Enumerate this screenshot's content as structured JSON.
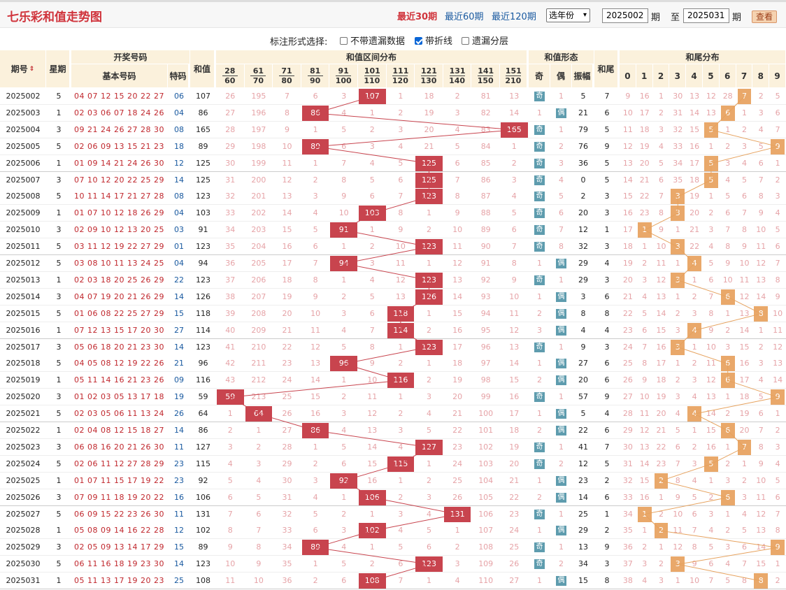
{
  "app": {
    "title": "七乐彩和值走势图",
    "ranges": [
      "最近30期",
      "最近60期",
      "最近120期"
    ],
    "year_select": "选年份",
    "from_issue": "2025002",
    "to_issue": "2025031",
    "period_label": "期",
    "to_label": "至",
    "query_button": "查看"
  },
  "options": {
    "label": "标注形式选择:",
    "items": [
      {
        "label": "不带遗漏数据",
        "checked": false
      },
      {
        "label": "带折线",
        "checked": true
      },
      {
        "label": "遗漏分层",
        "checked": false
      }
    ]
  },
  "headers": {
    "issue": "期号",
    "week": "星期",
    "draw": "开奖号码",
    "basic": "基本号码",
    "special": "特码",
    "sum": "和值",
    "zone_group": "和值区间分布",
    "zones": [
      [
        "28",
        "60"
      ],
      [
        "61",
        "70"
      ],
      [
        "71",
        "80"
      ],
      [
        "81",
        "90"
      ],
      [
        "91",
        "100"
      ],
      [
        "101",
        "110"
      ],
      [
        "111",
        "120"
      ],
      [
        "121",
        "130"
      ],
      [
        "131",
        "140"
      ],
      [
        "141",
        "150"
      ],
      [
        "151",
        "210"
      ]
    ],
    "form_group": "和值形态",
    "odd": "奇",
    "even": "偶",
    "amp": "振幅",
    "tail": "和尾",
    "tail_group": "和尾分布",
    "tail_digits": [
      "0",
      "1",
      "2",
      "3",
      "4",
      "5",
      "6",
      "7",
      "8",
      "9"
    ]
  },
  "rows": [
    {
      "issue": "2025002",
      "week": "5",
      "nums": "04 07 12 15 20 22 27",
      "sp": "06",
      "sum": "107",
      "zone": 5,
      "zmiss": [
        "26",
        "195",
        "7",
        "6",
        "3",
        "",
        "1",
        "18",
        "2",
        "81",
        "13"
      ],
      "odd": true,
      "fmiss": "1",
      "amp": "5",
      "tail": "7",
      "tmiss": [
        "9",
        "16",
        "1",
        "30",
        "13",
        "12",
        "28",
        "",
        "2",
        "5"
      ]
    },
    {
      "issue": "2025003",
      "week": "1",
      "nums": "02 03 06 07 18 24 26",
      "sp": "04",
      "sum": "86",
      "zone": 3,
      "zmiss": [
        "27",
        "196",
        "8",
        "",
        "4",
        "1",
        "2",
        "19",
        "3",
        "82",
        "14"
      ],
      "odd": false,
      "fmiss": "1",
      "amp": "21",
      "tail": "6",
      "tmiss": [
        "10",
        "17",
        "2",
        "31",
        "14",
        "13",
        "",
        "1",
        "3",
        "6"
      ]
    },
    {
      "issue": "2025004",
      "week": "3",
      "nums": "09 21 24 26 27 28 30",
      "sp": "08",
      "sum": "165",
      "zone": 10,
      "zmiss": [
        "28",
        "197",
        "9",
        "1",
        "5",
        "2",
        "3",
        "20",
        "4",
        "83",
        ""
      ],
      "odd": true,
      "fmiss": "1",
      "amp": "79",
      "tail": "5",
      "tmiss": [
        "11",
        "18",
        "3",
        "32",
        "15",
        "",
        "1",
        "2",
        "4",
        "7"
      ]
    },
    {
      "issue": "2025005",
      "week": "5",
      "nums": "02 06 09 13 15 21 23",
      "sp": "18",
      "sum": "89",
      "zone": 3,
      "zmiss": [
        "29",
        "198",
        "10",
        "",
        "6",
        "3",
        "4",
        "21",
        "5",
        "84",
        "1"
      ],
      "odd": true,
      "fmiss": "2",
      "amp": "76",
      "tail": "9",
      "tmiss": [
        "12",
        "19",
        "4",
        "33",
        "16",
        "1",
        "2",
        "3",
        "5",
        ""
      ]
    },
    {
      "issue": "2025006",
      "week": "1",
      "nums": "01 09 14 21 24 26 30",
      "sp": "12",
      "sum": "125",
      "zone": 7,
      "zmiss": [
        "30",
        "199",
        "11",
        "1",
        "7",
        "4",
        "5",
        "",
        "6",
        "85",
        "2"
      ],
      "odd": true,
      "fmiss": "3",
      "amp": "36",
      "tail": "5",
      "tmiss": [
        "13",
        "20",
        "5",
        "34",
        "17",
        "",
        "3",
        "4",
        "6",
        "1"
      ]
    },
    {
      "issue": "2025007",
      "week": "3",
      "nums": "07 10 12 20 22 25 29",
      "sp": "14",
      "sum": "125",
      "zone": 7,
      "zmiss": [
        "31",
        "200",
        "12",
        "2",
        "8",
        "5",
        "6",
        "",
        "7",
        "86",
        "3"
      ],
      "odd": true,
      "fmiss": "4",
      "amp": "0",
      "tail": "5",
      "tmiss": [
        "14",
        "21",
        "6",
        "35",
        "18",
        "",
        "4",
        "5",
        "7",
        "2"
      ]
    },
    {
      "issue": "2025008",
      "week": "5",
      "nums": "10 11 14 17 21 27 28",
      "sp": "08",
      "sum": "123",
      "zone": 7,
      "zmiss": [
        "32",
        "201",
        "13",
        "3",
        "9",
        "6",
        "7",
        "",
        "8",
        "87",
        "4"
      ],
      "odd": true,
      "fmiss": "5",
      "amp": "2",
      "tail": "3",
      "tmiss": [
        "15",
        "22",
        "7",
        "",
        "19",
        "1",
        "5",
        "6",
        "8",
        "3"
      ]
    },
    {
      "issue": "2025009",
      "week": "1",
      "nums": "01 07 10 12 18 26 29",
      "sp": "04",
      "sum": "103",
      "zone": 5,
      "zmiss": [
        "33",
        "202",
        "14",
        "4",
        "10",
        "",
        "8",
        "1",
        "9",
        "88",
        "5"
      ],
      "odd": true,
      "fmiss": "6",
      "amp": "20",
      "tail": "3",
      "tmiss": [
        "16",
        "23",
        "8",
        "",
        "20",
        "2",
        "6",
        "7",
        "9",
        "4"
      ]
    },
    {
      "issue": "2025010",
      "week": "3",
      "nums": "02 09 10 12 13 20 25",
      "sp": "03",
      "sum": "91",
      "zone": 4,
      "zmiss": [
        "34",
        "203",
        "15",
        "5",
        "",
        "1",
        "9",
        "2",
        "10",
        "89",
        "6"
      ],
      "odd": true,
      "fmiss": "7",
      "amp": "12",
      "tail": "1",
      "tmiss": [
        "17",
        "",
        "9",
        "1",
        "21",
        "3",
        "7",
        "8",
        "10",
        "5"
      ]
    },
    {
      "issue": "2025011",
      "week": "5",
      "nums": "03 11 12 19 22 27 29",
      "sp": "01",
      "sum": "123",
      "zone": 7,
      "zmiss": [
        "35",
        "204",
        "16",
        "6",
        "1",
        "2",
        "10",
        "",
        "11",
        "90",
        "7"
      ],
      "odd": true,
      "fmiss": "8",
      "amp": "32",
      "tail": "3",
      "tmiss": [
        "18",
        "1",
        "10",
        "",
        "22",
        "4",
        "8",
        "9",
        "11",
        "6"
      ]
    },
    {
      "issue": "2025012",
      "week": "5",
      "nums": "03 08 10 11 13 24 25",
      "sp": "04",
      "sum": "94",
      "zone": 4,
      "zmiss": [
        "36",
        "205",
        "17",
        "7",
        "",
        "3",
        "11",
        "1",
        "12",
        "91",
        "8"
      ],
      "odd": false,
      "fmiss": "1",
      "amp": "29",
      "tail": "4",
      "tmiss": [
        "19",
        "2",
        "11",
        "1",
        "",
        "5",
        "9",
        "10",
        "12",
        "7"
      ]
    },
    {
      "issue": "2025013",
      "week": "1",
      "nums": "02 03 18 20 25 26 29",
      "sp": "22",
      "sum": "123",
      "zone": 7,
      "zmiss": [
        "37",
        "206",
        "18",
        "8",
        "1",
        "4",
        "12",
        "",
        "13",
        "92",
        "9"
      ],
      "odd": true,
      "fmiss": "1",
      "amp": "29",
      "tail": "3",
      "tmiss": [
        "20",
        "3",
        "12",
        "",
        "1",
        "6",
        "10",
        "11",
        "13",
        "8"
      ]
    },
    {
      "issue": "2025014",
      "week": "3",
      "nums": "04 07 19 20 21 26 29",
      "sp": "14",
      "sum": "126",
      "zone": 7,
      "zmiss": [
        "38",
        "207",
        "19",
        "9",
        "2",
        "5",
        "13",
        "",
        "14",
        "93",
        "10"
      ],
      "odd": false,
      "fmiss": "1",
      "amp": "3",
      "tail": "6",
      "tmiss": [
        "21",
        "4",
        "13",
        "1",
        "2",
        "7",
        "",
        "12",
        "14",
        "9"
      ]
    },
    {
      "issue": "2025015",
      "week": "5",
      "nums": "01 06 08 22 25 27 29",
      "sp": "15",
      "sum": "118",
      "zone": 6,
      "zmiss": [
        "39",
        "208",
        "20",
        "10",
        "3",
        "6",
        "",
        "1",
        "15",
        "94",
        "11"
      ],
      "odd": false,
      "fmiss": "2",
      "amp": "8",
      "tail": "8",
      "tmiss": [
        "22",
        "5",
        "14",
        "2",
        "3",
        "8",
        "1",
        "13",
        "",
        "10"
      ]
    },
    {
      "issue": "2025016",
      "week": "1",
      "nums": "07 12 13 15 17 20 30",
      "sp": "27",
      "sum": "114",
      "zone": 6,
      "zmiss": [
        "40",
        "209",
        "21",
        "11",
        "4",
        "7",
        "",
        "2",
        "16",
        "95",
        "12"
      ],
      "odd": false,
      "fmiss": "3",
      "amp": "4",
      "tail": "4",
      "tmiss": [
        "23",
        "6",
        "15",
        "3",
        "",
        "9",
        "2",
        "14",
        "1",
        "11"
      ]
    },
    {
      "issue": "2025017",
      "week": "3",
      "nums": "05 06 18 20 21 23 30",
      "sp": "14",
      "sum": "123",
      "zone": 7,
      "zmiss": [
        "41",
        "210",
        "22",
        "12",
        "5",
        "8",
        "1",
        "",
        "17",
        "96",
        "13"
      ],
      "odd": true,
      "fmiss": "1",
      "amp": "9",
      "tail": "3",
      "tmiss": [
        "24",
        "7",
        "16",
        "",
        "1",
        "10",
        "3",
        "15",
        "2",
        "12"
      ]
    },
    {
      "issue": "2025018",
      "week": "5",
      "nums": "04 05 08 12 19 22 26",
      "sp": "21",
      "sum": "96",
      "zone": 4,
      "zmiss": [
        "42",
        "211",
        "23",
        "13",
        "",
        "9",
        "2",
        "1",
        "18",
        "97",
        "14"
      ],
      "odd": false,
      "fmiss": "1",
      "amp": "27",
      "tail": "6",
      "tmiss": [
        "25",
        "8",
        "17",
        "1",
        "2",
        "11",
        "",
        "16",
        "3",
        "13"
      ]
    },
    {
      "issue": "2025019",
      "week": "1",
      "nums": "05 11 14 16 21 23 26",
      "sp": "09",
      "sum": "116",
      "zone": 6,
      "zmiss": [
        "43",
        "212",
        "24",
        "14",
        "1",
        "10",
        "",
        "2",
        "19",
        "98",
        "15"
      ],
      "odd": false,
      "fmiss": "2",
      "amp": "20",
      "tail": "6",
      "tmiss": [
        "26",
        "9",
        "18",
        "2",
        "3",
        "12",
        "",
        "17",
        "4",
        "14"
      ]
    },
    {
      "issue": "2025020",
      "week": "3",
      "nums": "01 02 03 05 13 17 18",
      "sp": "19",
      "sum": "59",
      "zone": 0,
      "zmiss": [
        "",
        "213",
        "25",
        "15",
        "2",
        "11",
        "1",
        "3",
        "20",
        "99",
        "16"
      ],
      "odd": true,
      "fmiss": "1",
      "amp": "57",
      "tail": "9",
      "tmiss": [
        "27",
        "10",
        "19",
        "3",
        "4",
        "13",
        "1",
        "18",
        "5",
        ""
      ]
    },
    {
      "issue": "2025021",
      "week": "5",
      "nums": "02 03 05 06 11 13 24",
      "sp": "26",
      "sum": "64",
      "zone": 1,
      "zmiss": [
        "1",
        "",
        "26",
        "16",
        "3",
        "12",
        "2",
        "4",
        "21",
        "100",
        "17"
      ],
      "odd": false,
      "fmiss": "1",
      "amp": "5",
      "tail": "4",
      "tmiss": [
        "28",
        "11",
        "20",
        "4",
        "",
        "14",
        "2",
        "19",
        "6",
        "1"
      ]
    },
    {
      "issue": "2025022",
      "week": "1",
      "nums": "02 04 08 12 15 18 27",
      "sp": "14",
      "sum": "86",
      "zone": 3,
      "zmiss": [
        "2",
        "1",
        "27",
        "",
        "4",
        "13",
        "3",
        "5",
        "22",
        "101",
        "18"
      ],
      "odd": false,
      "fmiss": "2",
      "amp": "22",
      "tail": "6",
      "tmiss": [
        "29",
        "12",
        "21",
        "5",
        "1",
        "15",
        "",
        "20",
        "7",
        "2"
      ]
    },
    {
      "issue": "2025023",
      "week": "3",
      "nums": "06 08 16 20 21 26 30",
      "sp": "11",
      "sum": "127",
      "zone": 7,
      "zmiss": [
        "3",
        "2",
        "28",
        "1",
        "5",
        "14",
        "4",
        "",
        "23",
        "102",
        "19"
      ],
      "odd": true,
      "fmiss": "1",
      "amp": "41",
      "tail": "7",
      "tmiss": [
        "30",
        "13",
        "22",
        "6",
        "2",
        "16",
        "1",
        "",
        "8",
        "3"
      ]
    },
    {
      "issue": "2025024",
      "week": "5",
      "nums": "02 06 11 12 27 28 29",
      "sp": "23",
      "sum": "115",
      "zone": 6,
      "zmiss": [
        "4",
        "3",
        "29",
        "2",
        "6",
        "15",
        "",
        "1",
        "24",
        "103",
        "20"
      ],
      "odd": true,
      "fmiss": "2",
      "amp": "12",
      "tail": "5",
      "tmiss": [
        "31",
        "14",
        "23",
        "7",
        "3",
        "",
        "2",
        "1",
        "9",
        "4"
      ]
    },
    {
      "issue": "2025025",
      "week": "1",
      "nums": "01 07 11 15 17 19 22",
      "sp": "23",
      "sum": "92",
      "zone": 4,
      "zmiss": [
        "5",
        "4",
        "30",
        "3",
        "",
        "16",
        "1",
        "2",
        "25",
        "104",
        "21"
      ],
      "odd": false,
      "fmiss": "1",
      "amp": "23",
      "tail": "2",
      "tmiss": [
        "32",
        "15",
        "",
        "8",
        "4",
        "1",
        "3",
        "2",
        "10",
        "5"
      ]
    },
    {
      "issue": "2025026",
      "week": "3",
      "nums": "07 09 11 18 19 20 22",
      "sp": "16",
      "sum": "106",
      "zone": 5,
      "zmiss": [
        "6",
        "5",
        "31",
        "4",
        "1",
        "",
        "2",
        "3",
        "26",
        "105",
        "22"
      ],
      "odd": false,
      "fmiss": "2",
      "amp": "14",
      "tail": "6",
      "tmiss": [
        "33",
        "16",
        "1",
        "9",
        "5",
        "2",
        "",
        "3",
        "11",
        "6"
      ]
    },
    {
      "issue": "2025027",
      "week": "5",
      "nums": "06 09 15 22 23 26 30",
      "sp": "11",
      "sum": "131",
      "zone": 8,
      "zmiss": [
        "7",
        "6",
        "32",
        "5",
        "2",
        "1",
        "3",
        "4",
        "",
        "106",
        "23"
      ],
      "odd": true,
      "fmiss": "1",
      "amp": "25",
      "tail": "1",
      "tmiss": [
        "34",
        "",
        "2",
        "10",
        "6",
        "3",
        "1",
        "4",
        "12",
        "7"
      ]
    },
    {
      "issue": "2025028",
      "week": "1",
      "nums": "05 08 09 14 16 22 28",
      "sp": "12",
      "sum": "102",
      "zone": 5,
      "zmiss": [
        "8",
        "7",
        "33",
        "6",
        "3",
        "",
        "4",
        "5",
        "1",
        "107",
        "24"
      ],
      "odd": false,
      "fmiss": "1",
      "amp": "29",
      "tail": "2",
      "tmiss": [
        "35",
        "1",
        "",
        "11",
        "7",
        "4",
        "2",
        "5",
        "13",
        "8"
      ]
    },
    {
      "issue": "2025029",
      "week": "3",
      "nums": "02 05 09 13 14 17 29",
      "sp": "15",
      "sum": "89",
      "zone": 3,
      "zmiss": [
        "9",
        "8",
        "34",
        "",
        "4",
        "1",
        "5",
        "6",
        "2",
        "108",
        "25"
      ],
      "odd": true,
      "fmiss": "1",
      "amp": "13",
      "tail": "9",
      "tmiss": [
        "36",
        "2",
        "1",
        "12",
        "8",
        "5",
        "3",
        "6",
        "14",
        ""
      ]
    },
    {
      "issue": "2025030",
      "week": "5",
      "nums": "06 11 16 18 19 23 30",
      "sp": "14",
      "sum": "123",
      "zone": 7,
      "zmiss": [
        "10",
        "9",
        "35",
        "1",
        "5",
        "2",
        "6",
        "",
        "3",
        "109",
        "26"
      ],
      "odd": true,
      "fmiss": "2",
      "amp": "34",
      "tail": "3",
      "tmiss": [
        "37",
        "3",
        "2",
        "",
        "9",
        "6",
        "4",
        "7",
        "15",
        "1"
      ]
    },
    {
      "issue": "2025031",
      "week": "1",
      "nums": "05 11 13 17 19 20 23",
      "sp": "25",
      "sum": "108",
      "zone": 5,
      "zmiss": [
        "11",
        "10",
        "36",
        "2",
        "6",
        "",
        "7",
        "1",
        "4",
        "110",
        "27"
      ],
      "odd": false,
      "fmiss": "1",
      "amp": "15",
      "tail": "8",
      "tmiss": [
        "38",
        "4",
        "3",
        "1",
        "10",
        "7",
        "5",
        "8",
        "",
        "2"
      ]
    }
  ]
}
